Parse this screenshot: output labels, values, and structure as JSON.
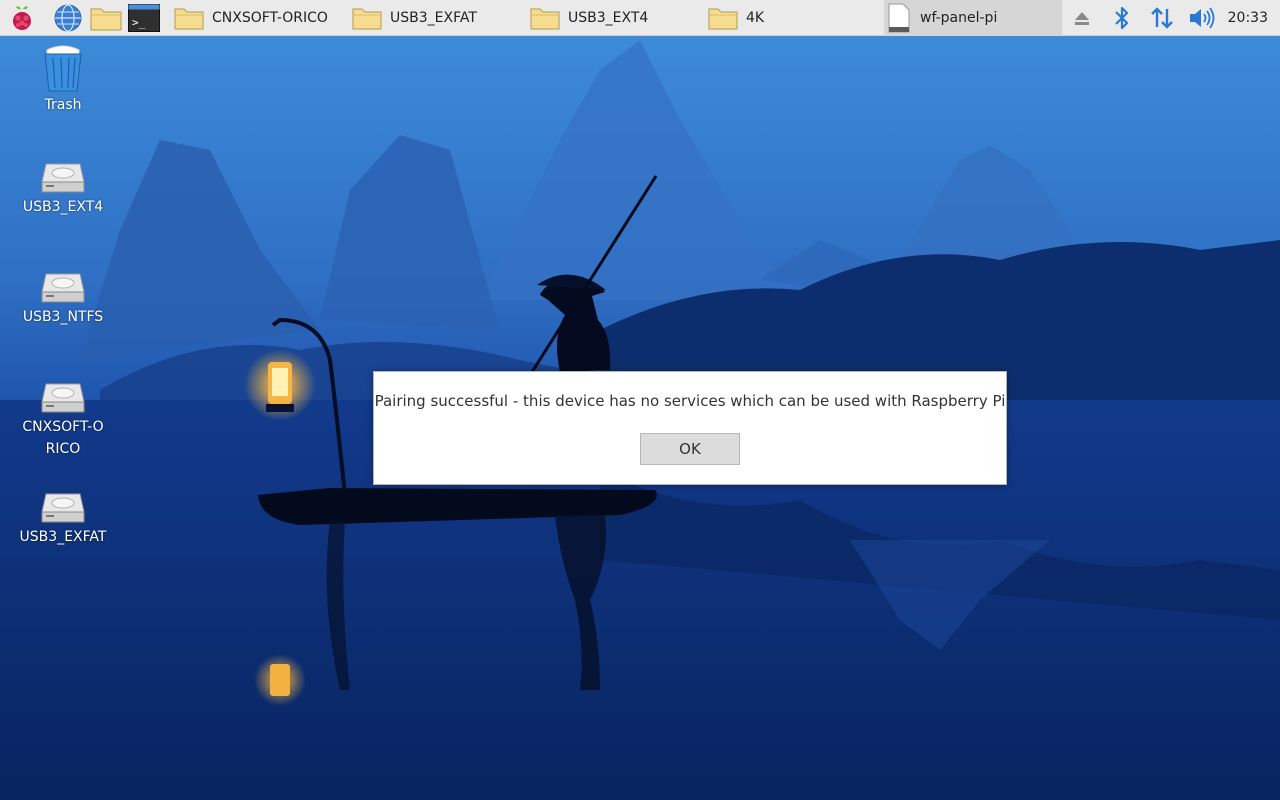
{
  "taskbar": {
    "windows": [
      {
        "label": "CNXSOFT-ORICO"
      },
      {
        "label": "USB3_EXFAT"
      },
      {
        "label": "USB3_EXT4"
      },
      {
        "label": "4K"
      },
      {
        "label": "wf-panel-pi",
        "active": true
      }
    ],
    "launchers": [
      "raspberry-menu-icon",
      "web-browser-icon",
      "file-manager-icon",
      "terminal-icon"
    ],
    "terminal_glyph": ">_",
    "tray": [
      "eject-icon",
      "bluetooth-icon",
      "network-arrows-icon",
      "volume-icon"
    ],
    "clock": "20:33"
  },
  "desktop": {
    "icons": [
      {
        "label": "Trash",
        "icon": "trash-icon"
      },
      {
        "label": "USB3_EXT4",
        "icon": "drive-icon"
      },
      {
        "label": "USB3_NTFS",
        "icon": "drive-icon"
      },
      {
        "label": "CNXSOFT-ORICO",
        "icon": "drive-icon"
      },
      {
        "label": "USB3_EXFAT",
        "icon": "drive-icon"
      }
    ]
  },
  "dialog": {
    "message": "Pairing successful - this device has no services which can be used with Raspberry Pi",
    "ok_label": "OK"
  },
  "colors": {
    "taskbar_bg": "#eaeaea",
    "accent_blue": "#2a7ad5",
    "sky_top": "#3b8bd8",
    "water": "#0a2a70"
  }
}
